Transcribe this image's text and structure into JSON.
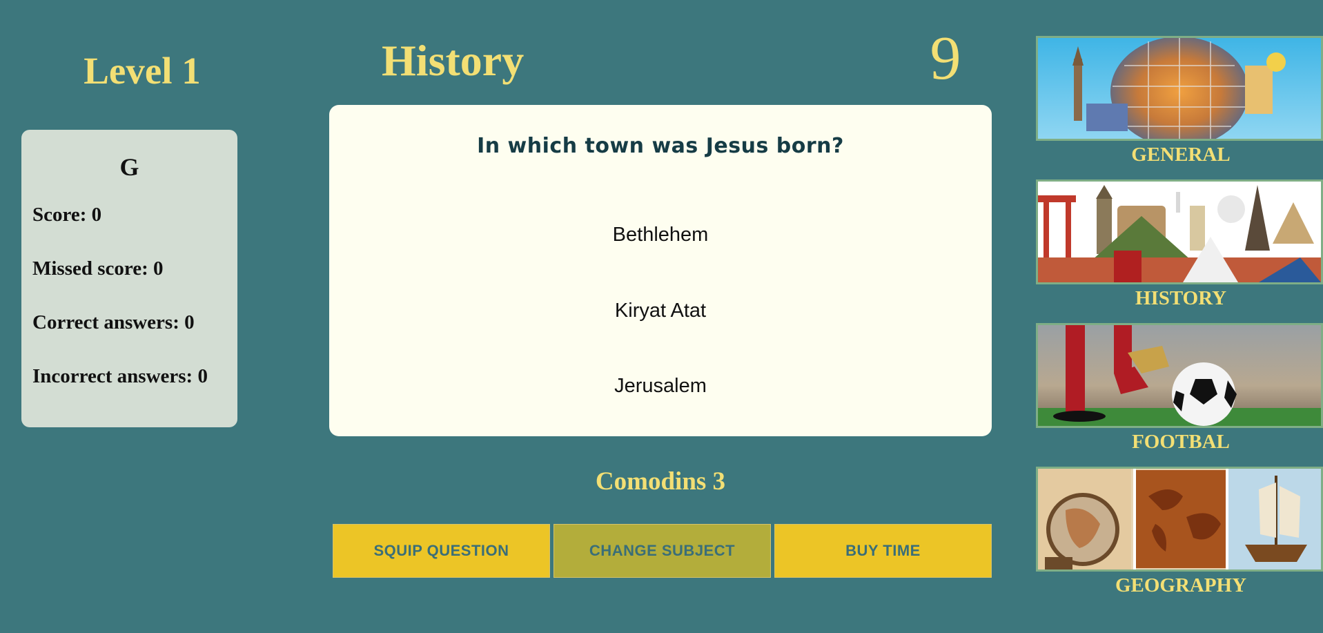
{
  "level": {
    "label": "Level 1"
  },
  "player": {
    "name": "G",
    "stats": [
      "Score: 0",
      "Missed score: 0",
      "Correct answers: 0",
      "Incorrect answers: 0"
    ]
  },
  "subject": {
    "title": "History"
  },
  "timer": {
    "value": "9"
  },
  "question": {
    "text": "In which town was Jesus born?",
    "answers": [
      "Bethlehem",
      "Kiryat Atat",
      "Jerusalem"
    ]
  },
  "comodins": {
    "label": "Comodins 3"
  },
  "buttons": {
    "skip": "SQUIP QUESTION",
    "change": "CHANGE SUBJECT",
    "buy": "BUY TIME"
  },
  "subjects": [
    {
      "label": "GENERAL",
      "icon": "globe-landmarks-image"
    },
    {
      "label": "HISTORY",
      "icon": "world-monuments-image"
    },
    {
      "label": "FOOTBAL",
      "icon": "football-image"
    },
    {
      "label": "GEOGRAPHY",
      "icon": "old-map-image"
    }
  ],
  "colors": {
    "background": "#3d777d",
    "accent_text": "#f3df74",
    "button": "#ecc526",
    "button_active": "#b3ad3b",
    "card": "#fefef0",
    "stats_card": "#d3ddd3"
  }
}
